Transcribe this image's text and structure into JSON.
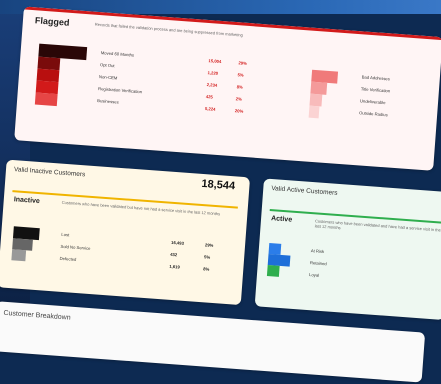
{
  "flagged": {
    "title": "Flagged",
    "desc": "Records that failed the validation process and are being suppressed from marketing",
    "rows": [
      {
        "label": "Moved 60 Months",
        "value": "15,004",
        "pct": "29%"
      },
      {
        "label": "Opt Out",
        "value": "1,220",
        "pct": "5%"
      },
      {
        "label": "Non-CEM",
        "value": "2,234",
        "pct": "8%"
      },
      {
        "label": "Registration Verification",
        "value": "425",
        "pct": "2%"
      },
      {
        "label": "Businesses",
        "value": "5,224",
        "pct": "20%"
      }
    ],
    "right_labels": [
      "Bad Addresses",
      "Title Verification",
      "Undeliverable",
      "Outside Radius"
    ]
  },
  "inactive": {
    "section_title": "Valid Inactive Customers",
    "total": "18,544",
    "title": "Inactive",
    "desc": "Customers who have been validated but have not had a service visit in the last 12 months",
    "rows": [
      {
        "label": "Lost",
        "value": "16,493",
        "pct": "29%"
      },
      {
        "label": "Sold No Service",
        "value": "432",
        "pct": "5%"
      },
      {
        "label": "Defected",
        "value": "1,619",
        "pct": "8%"
      }
    ]
  },
  "active": {
    "section_title": "Valid Active Customers",
    "title": "Active",
    "desc": "Customers who have been validated and have had a service visit in the last 12 months",
    "rows": [
      {
        "label": "At Risk"
      },
      {
        "label": "Retained"
      },
      {
        "label": "Loyal"
      }
    ]
  },
  "breakdown": {
    "title": "Customer Breakdown"
  }
}
